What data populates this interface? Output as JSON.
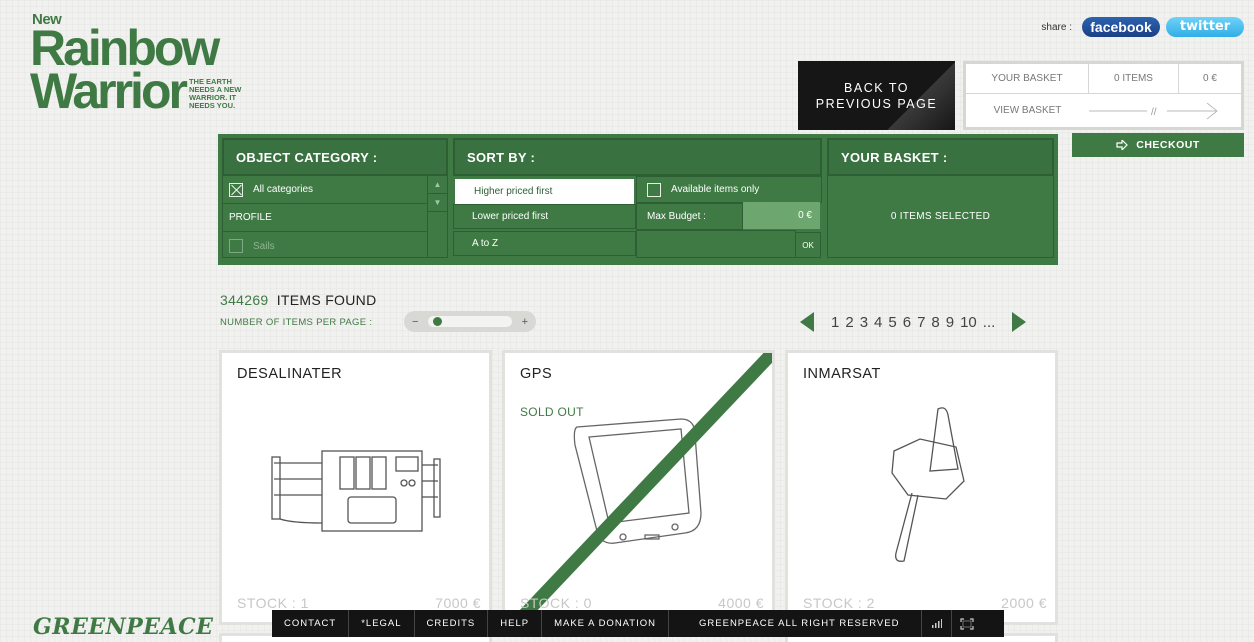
{
  "logo": {
    "new": "New",
    "line1": "Rainbow",
    "line2": "Warrior",
    "tagline": "THE EARTH NEEDS A NEW WARRIOR. IT NEEDS YOU."
  },
  "share": {
    "label": "share :",
    "facebook": "facebook",
    "twitter": "twitter"
  },
  "back_button": {
    "line1": "BACK TO",
    "line2": "PREVIOUS PAGE"
  },
  "basket": {
    "label": "YOUR BASKET",
    "items": "0 ITEMS",
    "total": "0 €",
    "view": "VIEW BASKET",
    "arrow_mark": "//",
    "checkout": "CHECKOUT"
  },
  "filters": {
    "category_title": "OBJECT CATEGORY :",
    "categories": [
      {
        "label": "All categories",
        "checked": true
      },
      {
        "label": "PROFILE",
        "checked": false
      },
      {
        "label": "Sails",
        "checked": false
      }
    ],
    "sort_title": "SORT BY :",
    "sort_options": [
      "Higher priced first",
      "Lower priced first",
      "A to Z"
    ],
    "active_sort": "Higher priced first",
    "available_only": "Available items only",
    "max_budget_label": "Max Budget :",
    "max_budget_value": "0 €",
    "ok": "OK",
    "basket_title": "YOUR BASKET :",
    "basket_summary": "0 ITEMS SELECTED"
  },
  "results": {
    "count": "344269",
    "found_label": "ITEMS FOUND",
    "per_page_label": "NUMBER OF ITEMS PER PAGE :",
    "minus": "−",
    "plus": "+",
    "pages": [
      "1",
      "2",
      "3",
      "4",
      "5",
      "6",
      "7",
      "8",
      "9",
      "10",
      "..."
    ]
  },
  "products": [
    {
      "name": "DESALINATER",
      "stock": "STOCK : 1",
      "price": "7000 €",
      "sold_out": "",
      "icon": "desalinator-icon"
    },
    {
      "name": "GPS",
      "stock": "STOCK : 0",
      "price": "4000 €",
      "sold_out": "SOLD OUT",
      "icon": "gps-icon"
    },
    {
      "name": "INMARSAT",
      "stock": "STOCK : 2",
      "price": "2000 €",
      "sold_out": "",
      "icon": "antenna-icon"
    }
  ],
  "footer": {
    "brand": "GREENPEACE",
    "links": [
      "CONTACT",
      "*LEGAL",
      "CREDITS",
      "HELP",
      "MAKE A DONATION"
    ],
    "rights": "GREENPEACE ALL RIGHT RESERVED"
  },
  "colors": {
    "brand_green": "#3f7a45",
    "dark_green": "#2e5e34",
    "footer_bg": "#141414"
  }
}
